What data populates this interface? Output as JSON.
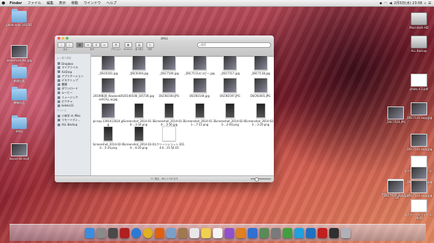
{
  "menubar": {
    "apple": "",
    "items": [
      "Finder",
      "ファイル",
      "編集",
      "表示",
      "移動",
      "ウインドウ",
      "ヘルプ"
    ],
    "clock": "2月5日(水) 23:58"
  },
  "desktop_left": [
    {
      "label": "photo only 140201",
      "icon": "folder-icon",
      "kind": "folder"
    },
    {
      "label": "watermark2kk.jpg",
      "icon": "image-file-icon",
      "kind": "photo"
    },
    {
      "label": "新規企画",
      "icon": "folder-icon",
      "kind": "folder"
    },
    {
      "label": "映像作品",
      "icon": "folder-icon",
      "kind": "folder"
    },
    {
      "label": "(IMG)",
      "icon": "folder-icon",
      "kind": "folder"
    },
    {
      "label": "koyashiki.mp4",
      "icon": "video-file-icon",
      "kind": "photo"
    }
  ],
  "desktop_right": [
    {
      "label": "Macintosh HD",
      "icon": "hard-drive-icon",
      "kind": "disk"
    },
    {
      "label": "ALL Backup",
      "icon": "backup-drive-icon",
      "kind": "disk"
    },
    {
      "label": "photo 4 2.pdf",
      "icon": "pdf-file-icon",
      "kind": "doc"
    },
    {
      "label": "_DSC7131 copy.jpg",
      "icon": "image-file-icon",
      "kind": "photo"
    },
    {
      "label": "_DSC7533.JPG",
      "icon": "image-file-icon",
      "kind": "photo"
    },
    {
      "label": "_DSC7141 copy.jpg",
      "icon": "image-file-icon",
      "kind": "photo"
    },
    {
      "label": "スクリーンショット 2...29.01",
      "icon": "screenshot-file-icon",
      "kind": "doc"
    },
    {
      "label": "_DSC7525 copy.jpg",
      "icon": "image-file-icon",
      "kind": "photo"
    },
    {
      "label": "スクリーンショット...37.29",
      "icon": "screenshot-file-icon",
      "kind": "doc"
    },
    {
      "label": "_DSC7533 copy.jpg",
      "icon": "image-file-icon",
      "kind": "photo"
    },
    {
      "label": "_DSC7123 copy.jpg",
      "icon": "image-file-icon",
      "kind": "photo"
    },
    {
      "label": "スクリーンショット 2...29.01",
      "icon": "screenshot-file-icon",
      "kind": "doc"
    }
  ],
  "finder": {
    "title": "(IMG)",
    "toolbar": {
      "back_label": "戻る",
      "view_label": "表示",
      "arrange_label": "アクション",
      "share_label": "Dropbox",
      "sort_label": "並べ替え",
      "action_label": "共有",
      "search_placeholder": "検索"
    },
    "sidebar": {
      "favorites_header": "よく使う項目",
      "favorites": [
        "Dropbox",
        "マイファイル",
        "AirDrop",
        "アプリケーション",
        "デスクトップ",
        "書類",
        "ダウンロード",
        "ムービー",
        "ミュージック",
        "ピクチャ",
        "kokeia11"
      ],
      "devices_header": "デバイス",
      "devices": [
        "小林学 の iMac",
        "リモートディ...",
        "ALL Backup"
      ]
    },
    "files": [
      {
        "name": "_DSC6161.jpg",
        "kind": "photo"
      },
      {
        "name": "_DSC6304.jpg",
        "kind": "photo"
      },
      {
        "name": "_DSC7104.jpg",
        "kind": "photo"
      },
      {
        "name": "_DSC7111のコピー.jpg",
        "kind": "photo"
      },
      {
        "name": "_DSC7117.jpg",
        "kind": "photo"
      },
      {
        "name": "_DSC7118.jpg",
        "kind": "photo"
      },
      {
        "name": "20109830_KawasakiRockCity_w.jpg",
        "kind": "photo"
      },
      {
        "name": "20140108_165736.jpg",
        "kind": "photo"
      },
      {
        "name": "DSCN1500.JPG",
        "kind": "photo"
      },
      {
        "name": "DSCN1544.jpg",
        "kind": "photo"
      },
      {
        "name": "DSCN1597.JPG",
        "kind": "photo"
      },
      {
        "name": "DSCN1601.JPG",
        "kind": "photo"
      },
      {
        "name": "picsay-1391413024.jpg",
        "kind": "photo"
      },
      {
        "name": "Screenshot_2014-01-30-...3-34.png",
        "kind": "phone"
      },
      {
        "name": "Screenshot_2014-01-30-...3-56.jpg",
        "kind": "phone"
      },
      {
        "name": "Screenshot_2014-01-31-...7-15.png",
        "kind": "phone"
      },
      {
        "name": "Screenshot_2014-02-03-...2-00.png",
        "kind": "phone"
      },
      {
        "name": "Screenshot_2014-02-03-...3-20.png",
        "kind": "phone"
      },
      {
        "name": "Screenshot_2014-02-03-...5-34.png",
        "kind": "phone"
      },
      {
        "name": "Screenshot_2014-02-04-...6-20.png",
        "kind": "phone"
      },
      {
        "name": "スクリーンショット 2014-0...15.54.05",
        "kind": "doc"
      }
    ],
    "status": "21 項目、861.4 GB 空き"
  },
  "dock": [
    {
      "name": "finder-icon",
      "color": "#3b8de0"
    },
    {
      "name": "launchpad-icon",
      "color": "#8a8a8a"
    },
    {
      "name": "mission-control-icon",
      "color": "#4a4a4a"
    },
    {
      "name": "photo-booth-icon",
      "color": "#b02020"
    },
    {
      "name": "safari-icon",
      "color": "#2a7ad4"
    },
    {
      "name": "chrome-icon",
      "color": "#e0b020"
    },
    {
      "name": "firefox-icon",
      "color": "#e06010"
    },
    {
      "name": "mail-icon",
      "color": "#7aa0c8"
    },
    {
      "name": "contacts-icon",
      "color": "#a07850"
    },
    {
      "name": "calendar-icon",
      "color": "#e8e8e8"
    },
    {
      "name": "notes-icon",
      "color": "#f0d050"
    },
    {
      "name": "reminders-icon",
      "color": "#f4f4f4"
    },
    {
      "name": "itunes-icon",
      "color": "#9050d0"
    },
    {
      "name": "ibooks-icon",
      "color": "#e08020"
    },
    {
      "name": "app-store-icon",
      "color": "#3070d0"
    },
    {
      "name": "preview-icon",
      "color": "#5a8a5a"
    },
    {
      "name": "system-preferences-icon",
      "color": "#7a7a7a"
    },
    {
      "name": "evernote-icon",
      "color": "#40a040"
    },
    {
      "name": "skype-icon",
      "color": "#20a0e0"
    },
    {
      "name": "dropbox-icon",
      "color": "#2070c0"
    },
    {
      "name": "acrobat-icon",
      "color": "#c02020"
    },
    {
      "name": "terminal-icon",
      "color": "#303030"
    },
    {
      "name": "trash-icon",
      "color": "#b0b0b8"
    }
  ]
}
